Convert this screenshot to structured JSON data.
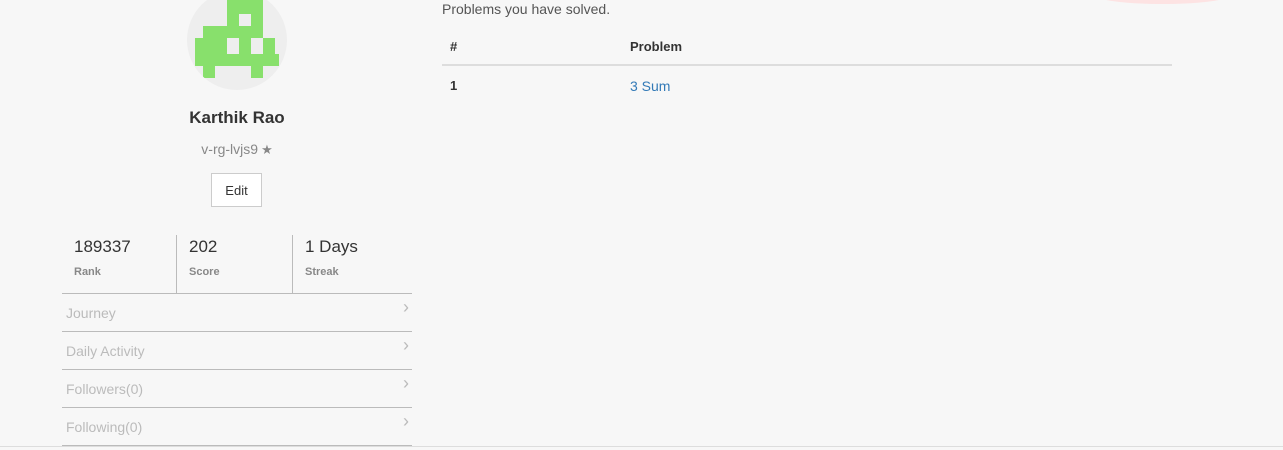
{
  "profile": {
    "name": "Karthik Rao",
    "handle": "v-rg-lvjs9",
    "edit_label": "Edit",
    "avatar_color": "#88e06c"
  },
  "stats": [
    {
      "value": "189337",
      "label": "Rank"
    },
    {
      "value": "202",
      "label": "Score"
    },
    {
      "value": "1 Days",
      "label": "Streak"
    }
  ],
  "menu": [
    {
      "label": "Journey"
    },
    {
      "label": "Daily Activity"
    },
    {
      "label": "Followers(0)"
    },
    {
      "label": "Following(0)"
    }
  ],
  "solved": {
    "caption": "Problems you have solved.",
    "headers": [
      "#",
      "Problem"
    ],
    "rows": [
      {
        "num": "1",
        "problem": "3 Sum"
      }
    ]
  },
  "colors": {
    "link": "#337ab7",
    "background": "#f7f7f7"
  }
}
